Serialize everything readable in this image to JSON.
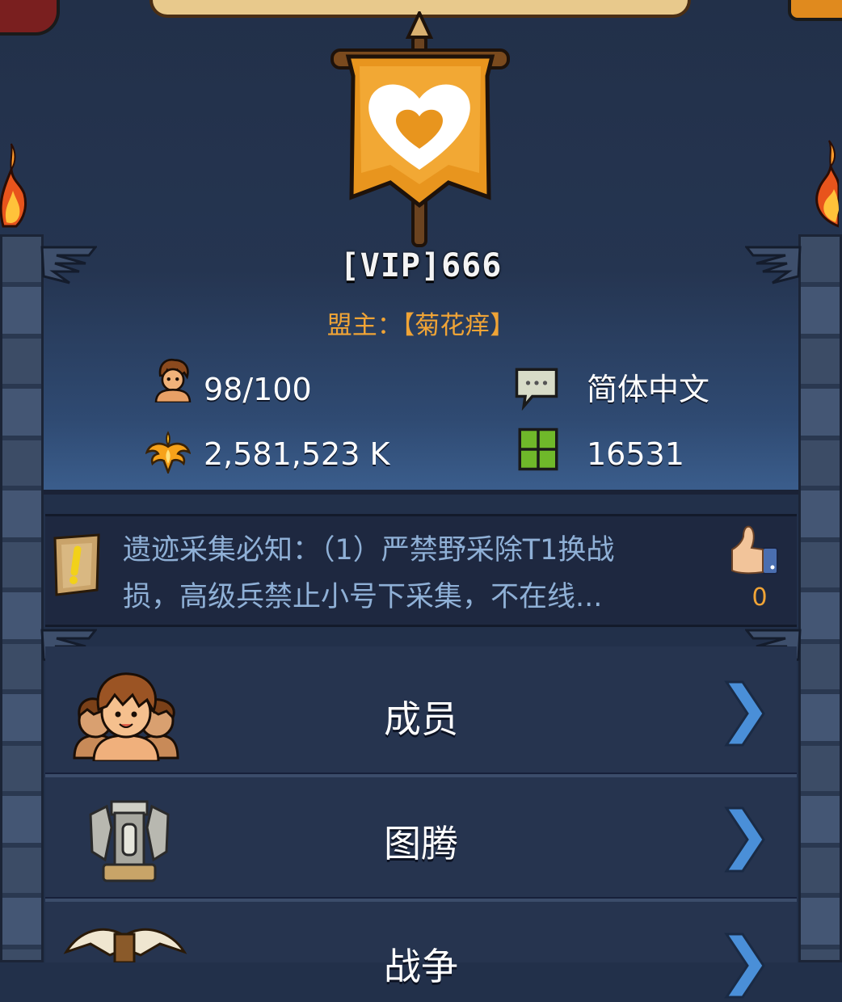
{
  "alliance": {
    "name": "[VIP]666",
    "leader_label": "盟主：",
    "leader_name": "【菊花痒】"
  },
  "stats": {
    "members": "98/100",
    "power": "2,581,523 K",
    "language": "简体中文",
    "territory": "16531"
  },
  "notice": {
    "text_line1": "遗迹采集必知：（1）严禁野采除T1换战",
    "text_line2": "损，高级兵禁止小号下采集，不在线...",
    "likes": "0"
  },
  "menu": {
    "items": [
      {
        "label": "成员",
        "icon": "members-icon"
      },
      {
        "label": "图腾",
        "icon": "totem-icon"
      },
      {
        "label": "战争",
        "icon": "war-icon"
      }
    ]
  },
  "colors": {
    "accent_orange": "#f0a436",
    "banner_orange": "#e8951e",
    "notice_text": "#8fb0d6",
    "panel_dark": "#1e2840"
  }
}
